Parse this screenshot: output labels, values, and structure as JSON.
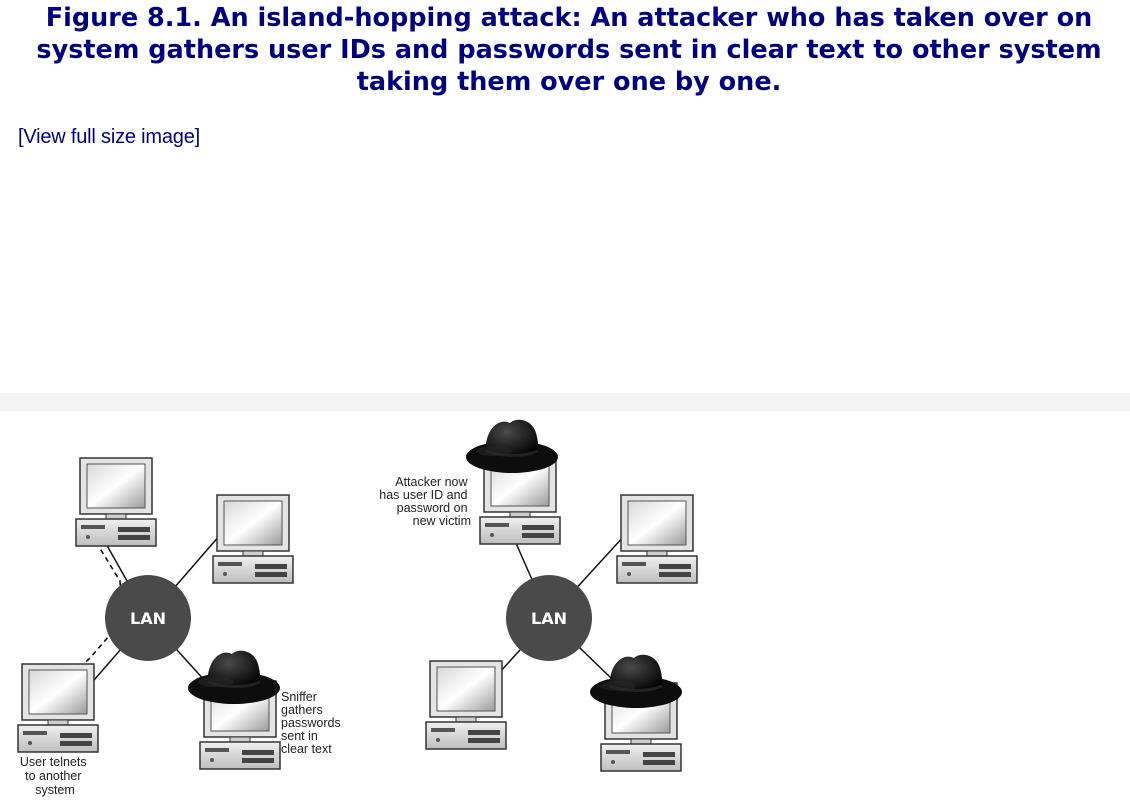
{
  "caption": {
    "line1": "Figure 8.1. An island-hopping attack: An attacker who has taken over on",
    "line2": "system gathers user IDs and passwords sent in clear text to other system",
    "line3": "taking them over one by one."
  },
  "view_link": "[View full size image]",
  "figure": {
    "left_panel": {
      "hub_label": "LAN",
      "sniffer_note": [
        "Sniffer",
        "gathers",
        "passwords",
        "sent in",
        "clear text"
      ],
      "user_note": [
        "User telnets",
        "to another",
        "system"
      ]
    },
    "right_panel": {
      "hub_label": "LAN",
      "attacker_note": [
        "Attacker now",
        "has user ID and",
        "password on",
        "new victim"
      ]
    }
  },
  "colors": {
    "caption": "#000080",
    "link": "#000080",
    "hub": "#4a4a4a",
    "hat": "#1a1a1a"
  }
}
